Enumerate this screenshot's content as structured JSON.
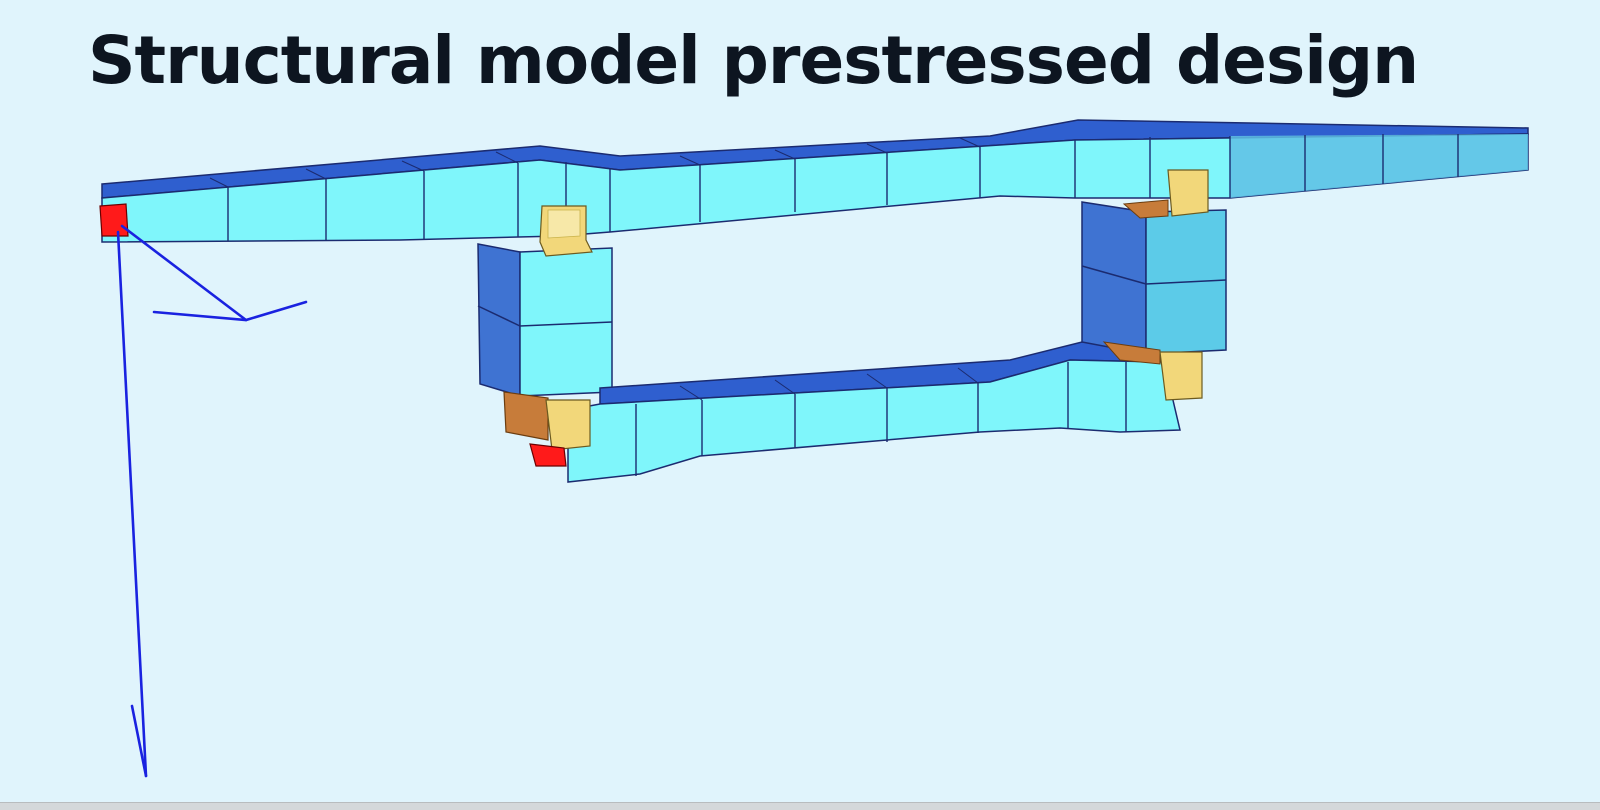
{
  "slide": {
    "title": "Structural model prestressed design"
  },
  "colors": {
    "background": "#e0f4fc",
    "title": "#0d1520",
    "deck_side": "#7ff6fb",
    "deck_top": "#2f5fcf",
    "pier_side": "#4a8cd6",
    "bearing": "#f2d77a",
    "bearing_shadow": "#c77c3a",
    "support": "#ff1a1a",
    "axis": "#1a22e0"
  },
  "icons": {
    "support_nodes": "red-square-icon",
    "axis_triad": "coordinate-axes-icon"
  }
}
